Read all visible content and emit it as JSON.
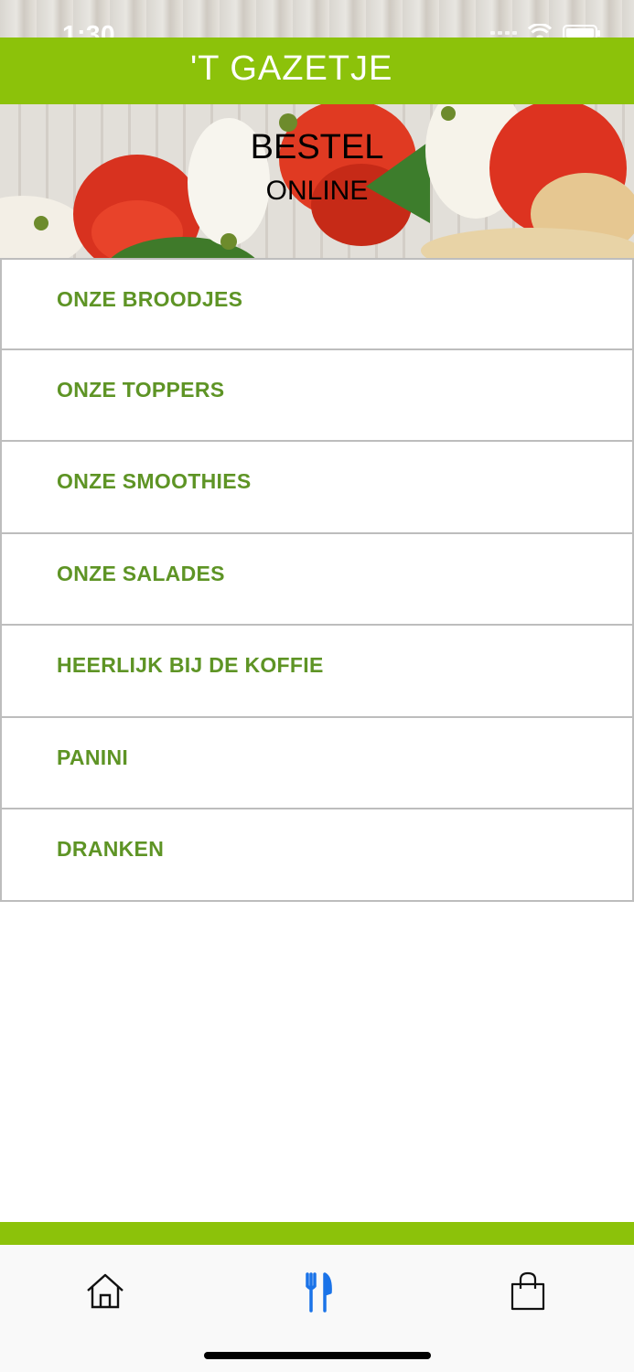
{
  "status_bar": {
    "time": "1:30"
  },
  "header": {
    "title": "'T GAZETJE"
  },
  "banner": {
    "line1": "BESTEL",
    "line2": "ONLINE"
  },
  "menu": {
    "items": [
      {
        "label": "ONZE BROODJES"
      },
      {
        "label": "ONZE TOPPERS"
      },
      {
        "label": "ONZE SMOOTHIES"
      },
      {
        "label": "ONZE SALADES"
      },
      {
        "label": "HEERLIJK BIJ DE KOFFIE"
      },
      {
        "label": "PANINI"
      },
      {
        "label": "DRANKEN"
      }
    ]
  },
  "tabbar": {
    "tabs": [
      {
        "icon": "home-icon",
        "active": false
      },
      {
        "icon": "fork-knife-icon",
        "active": true
      },
      {
        "icon": "shopping-bag-icon",
        "active": false
      }
    ]
  },
  "colors": {
    "brand_green": "#8cc20a",
    "label_green": "#5e9425",
    "active_tab": "#1a73e8"
  }
}
